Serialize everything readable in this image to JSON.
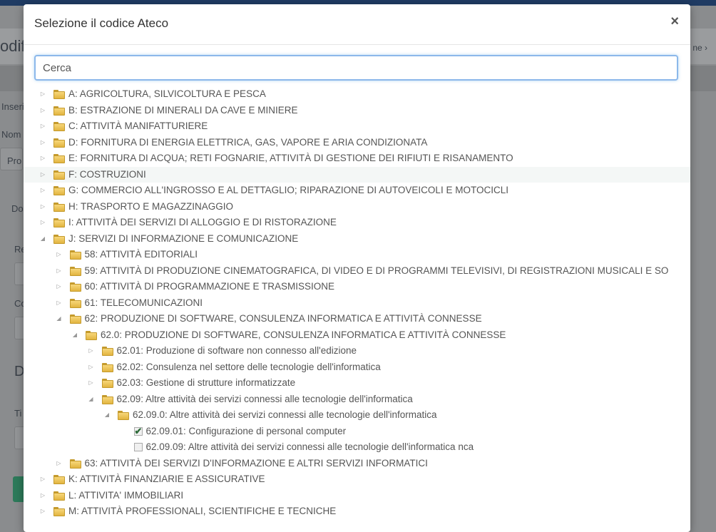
{
  "modal": {
    "title": "Selezione il codice Ateco",
    "close_label": "×",
    "search_placeholder": "Cerca"
  },
  "background": {
    "title_fragment": "odifi",
    "crumb_fragment": "ne  ›",
    "sidebar_labels": [
      "Inseri",
      "Nom",
      "Pro",
      "Do",
      "Re",
      "Co",
      "D",
      "Ti"
    ]
  },
  "tree": [
    {
      "level": 0,
      "state": "collapsed",
      "kind": "folder",
      "label": "A: AGRICOLTURA, SILVICOLTURA E PESCA"
    },
    {
      "level": 0,
      "state": "collapsed",
      "kind": "folder",
      "label": "B: ESTRAZIONE DI MINERALI DA CAVE E MINIERE"
    },
    {
      "level": 0,
      "state": "collapsed",
      "kind": "folder",
      "label": "C: ATTIVITÀ MANIFATTURIERE"
    },
    {
      "level": 0,
      "state": "collapsed",
      "kind": "folder",
      "label": "D: FORNITURA DI ENERGIA ELETTRICA, GAS, VAPORE E ARIA CONDIZIONATA"
    },
    {
      "level": 0,
      "state": "collapsed",
      "kind": "folder",
      "label": "E: FORNITURA DI ACQUA; RETI FOGNARIE, ATTIVITÀ DI GESTIONE DEI RIFIUTI E RISANAMENTO"
    },
    {
      "level": 0,
      "state": "collapsed",
      "kind": "folder",
      "label": "F: COSTRUZIONI",
      "highlight": true
    },
    {
      "level": 0,
      "state": "collapsed",
      "kind": "folder",
      "label": "G: COMMERCIO ALL'INGROSSO E AL DETTAGLIO; RIPARAZIONE DI AUTOVEICOLI E MOTOCICLI"
    },
    {
      "level": 0,
      "state": "collapsed",
      "kind": "folder",
      "label": "H: TRASPORTO E MAGAZZINAGGIO"
    },
    {
      "level": 0,
      "state": "collapsed",
      "kind": "folder",
      "label": "I: ATTIVITÀ DEI SERVIZI DI ALLOGGIO E DI RISTORAZIONE"
    },
    {
      "level": 0,
      "state": "expanded",
      "kind": "folder",
      "label": "J: SERVIZI DI INFORMAZIONE E COMUNICAZIONE"
    },
    {
      "level": 1,
      "state": "collapsed",
      "kind": "folder",
      "label": "58: ATTIVITÀ EDITORIALI"
    },
    {
      "level": 1,
      "state": "collapsed",
      "kind": "folder",
      "label": "59: ATTIVITÀ DI PRODUZIONE CINEMATOGRAFICA, DI VIDEO E DI PROGRAMMI TELEVISIVI, DI REGISTRAZIONI MUSICALI E SO"
    },
    {
      "level": 1,
      "state": "collapsed",
      "kind": "folder",
      "label": "60: ATTIVITÀ DI PROGRAMMAZIONE E TRASMISSIONE"
    },
    {
      "level": 1,
      "state": "collapsed",
      "kind": "folder",
      "label": "61: TELECOMUNICAZIONI"
    },
    {
      "level": 1,
      "state": "expanded",
      "kind": "folder",
      "label": "62: PRODUZIONE DI SOFTWARE, CONSULENZA INFORMATICA E ATTIVITÀ CONNESSE"
    },
    {
      "level": 2,
      "state": "expanded",
      "kind": "folder",
      "label": "62.0: PRODUZIONE DI SOFTWARE, CONSULENZA INFORMATICA E ATTIVITÀ CONNESSE"
    },
    {
      "level": 3,
      "state": "collapsed",
      "kind": "folder",
      "label": "62.01: Produzione di software non connesso all'edizione"
    },
    {
      "level": 3,
      "state": "collapsed",
      "kind": "folder",
      "label": "62.02: Consulenza nel settore delle tecnologie dell'informatica"
    },
    {
      "level": 3,
      "state": "collapsed",
      "kind": "folder",
      "label": "62.03: Gestione di strutture informatizzate"
    },
    {
      "level": 3,
      "state": "expanded",
      "kind": "folder",
      "label": "62.09: Altre attività dei servizi connessi alle tecnologie dell'informatica"
    },
    {
      "level": 4,
      "state": "expanded",
      "kind": "folder",
      "label": "62.09.0: Altre attività dei servizi connessi alle tecnologie dell'informatica"
    },
    {
      "level": 5,
      "state": "leaf",
      "kind": "check",
      "checked": true,
      "label": "62.09.01: Configurazione di personal computer"
    },
    {
      "level": 5,
      "state": "leaf",
      "kind": "check",
      "checked": false,
      "label": "62.09.09: Altre attività dei servizi connessi alle tecnologie dell'informatica nca"
    },
    {
      "level": 1,
      "state": "collapsed",
      "kind": "folder",
      "label": "63: ATTIVITÀ DEI SERVIZI D'INFORMAZIONE E ALTRI SERVIZI INFORMATICI"
    },
    {
      "level": 0,
      "state": "collapsed",
      "kind": "folder",
      "label": "K: ATTIVITÀ FINANZIARIE E ASSICURATIVE"
    },
    {
      "level": 0,
      "state": "collapsed",
      "kind": "folder",
      "label": "L: ATTIVITA' IMMOBILIARI"
    },
    {
      "level": 0,
      "state": "collapsed",
      "kind": "folder",
      "label": "M: ATTIVITÀ PROFESSIONALI, SCIENTIFICHE E TECNICHE"
    }
  ]
}
